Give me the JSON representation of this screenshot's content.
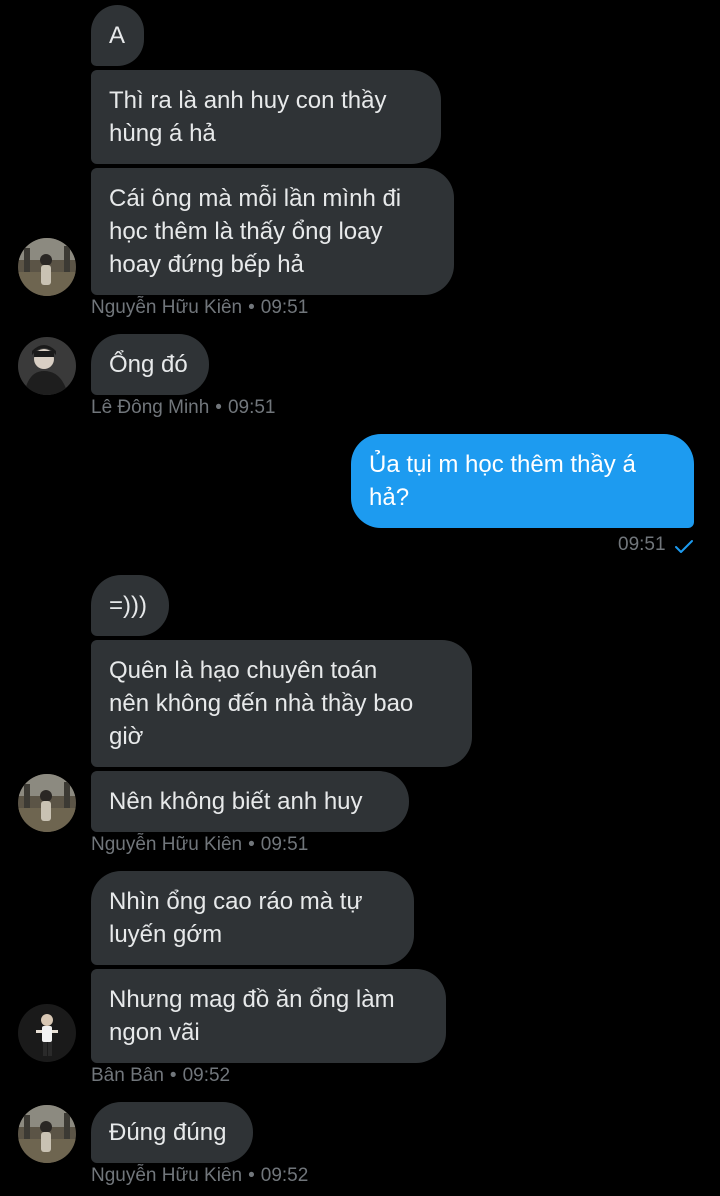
{
  "colors": {
    "background": "#000000",
    "incoming_bubble": "#2f3336",
    "outgoing_bubble": "#1d9bf0",
    "meta_text": "#71767b",
    "check": "#1d9bf0"
  },
  "messages": {
    "m1": "A",
    "m2": "Thì ra là anh huy con thầy\nhùng á hả",
    "m3": "Cái ông mà mỗi lần mình đi\nhọc thêm là thấy ổng loay\nhoay đứng bếp hả",
    "m4": "Ổng đó",
    "m5": "Ủa tụi m học thêm thầy á\nhả?",
    "m6": "=)))",
    "m7": "Quên là hạo chuyên toán\nnên không đến nhà thầy bao\ngiờ",
    "m8": "Nên không biết anh huy",
    "m9": "Nhìn ổng cao ráo mà tự\nluyến gớm",
    "m10": "Nhưng mag đồ ăn ổng làm\nngon vãi",
    "m11": "Đúng đúng"
  },
  "meta": {
    "g1_sender": "Nguyễn Hữu Kiên",
    "g1_time": "09:51",
    "g2_sender": "Lê Đông Minh",
    "g2_time": "09:51",
    "g3_time": "09:51",
    "g4_sender": "Nguyễn Hữu Kiên",
    "g4_time": "09:51",
    "g5_sender": "Bân Bân",
    "g5_time": "09:52",
    "g6_sender": "Nguyễn Hữu Kiên",
    "g6_time": "09:52",
    "separator": "•"
  },
  "icons": {
    "sent_status": "checkmark-icon",
    "avatars": [
      "avatar-nguyen-huu-kien",
      "avatar-le-dong-minh",
      "avatar-ban-ban"
    ]
  }
}
